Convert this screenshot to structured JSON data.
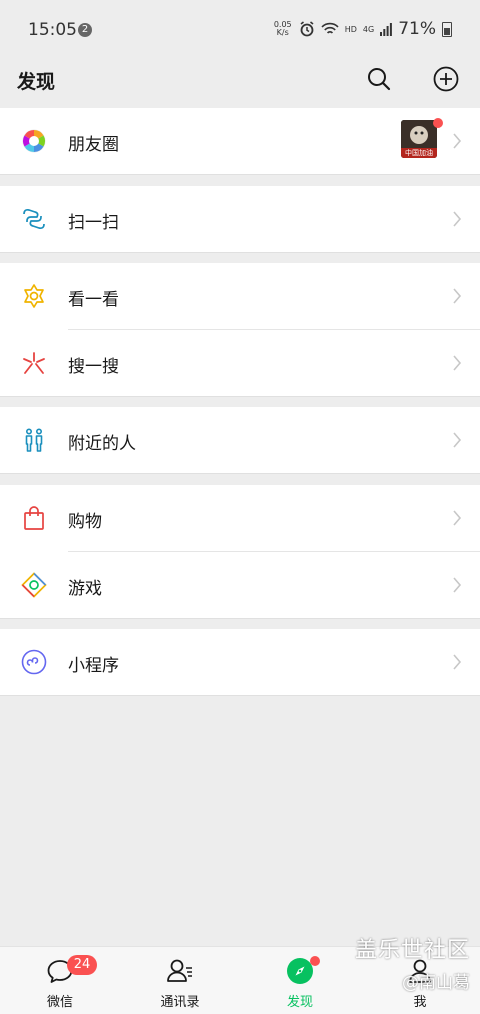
{
  "status_bar": {
    "time": "15:05",
    "notification_count": "2",
    "net_speed_value": "0.05",
    "net_speed_unit": "K/s",
    "hd_label": "HD",
    "network_label": "4G",
    "battery": "71%"
  },
  "header": {
    "title": "发现"
  },
  "menu": {
    "moments": "朋友圈",
    "moments_thumb_text": "中国加油",
    "scan": "扫一扫",
    "top_stories": "看一看",
    "search": "搜一搜",
    "people_nearby": "附近的人",
    "shopping": "购物",
    "games": "游戏",
    "mini_programs": "小程序"
  },
  "tabbar": {
    "chats": "微信",
    "chats_badge": "24",
    "contacts": "通讯录",
    "discover": "发现",
    "me": "我"
  },
  "watermark": {
    "line1": "盖乐世社区",
    "line2": "@南山葛"
  },
  "colors": {
    "accent": "#07c160",
    "badge": "#fa5151",
    "background": "#ededed"
  }
}
